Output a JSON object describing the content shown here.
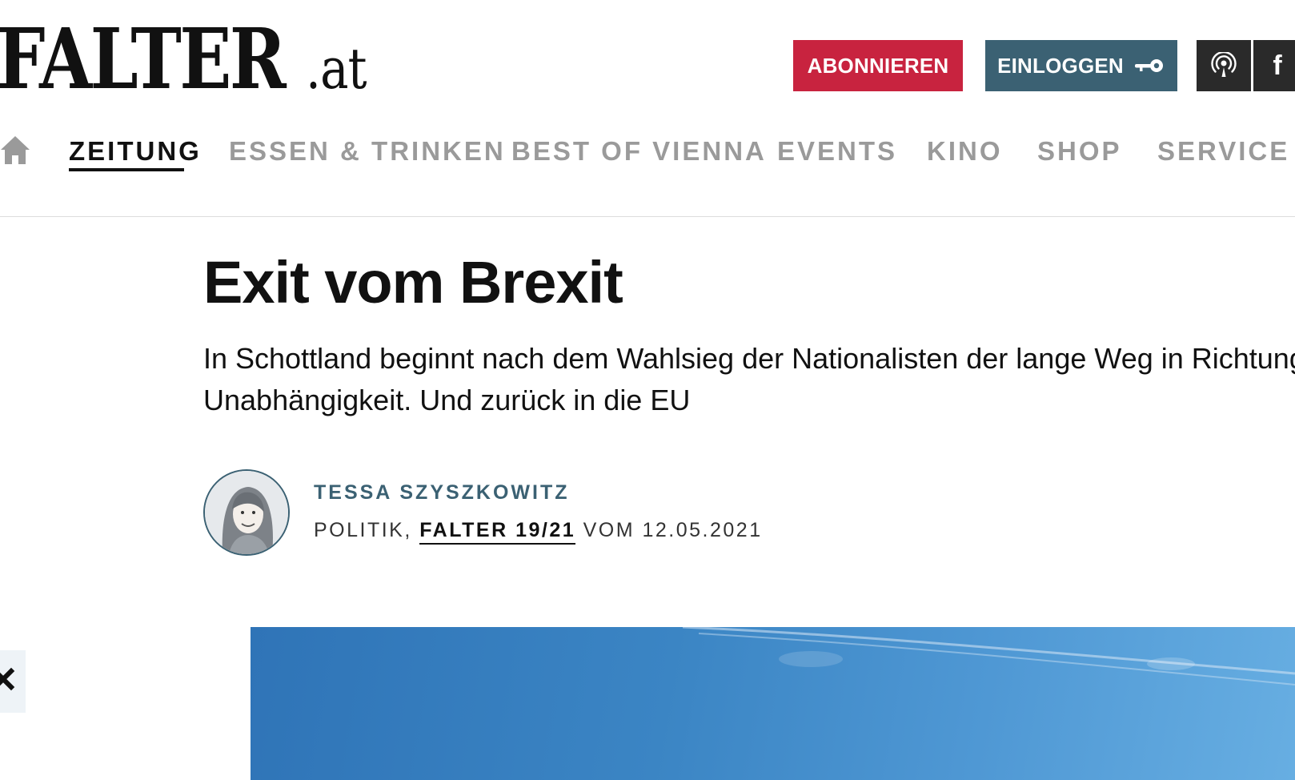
{
  "header": {
    "logo_main": "FALTER",
    "logo_suffix": ".at",
    "subscribe_label": "ABONNIEREN",
    "login_label": "EINLOGGEN",
    "icons": {
      "login": "key-icon",
      "podcast": "podcast-icon",
      "social": "facebook-icon"
    },
    "facebook_glyph": "f"
  },
  "nav": {
    "home_icon": "home-icon",
    "items": [
      {
        "label": "ZEITUNG",
        "active": true
      },
      {
        "label": "ESSEN & TRINKEN"
      },
      {
        "label": "BEST OF VIENNA"
      },
      {
        "label": "EVENTS"
      },
      {
        "label": "KINO"
      },
      {
        "label": "SHOP"
      },
      {
        "label": "SERVICE"
      }
    ]
  },
  "article": {
    "title": "Exit vom Brexit",
    "subtitle_line1": "In Schottland beginnt nach dem Wahlsieg der Nationalisten der lange Weg in Richtung",
    "subtitle_line2": "Unabhängigkeit. Und zurück in die EU",
    "author": "TESSA SZYSZKOWITZ",
    "section": "POLITIK, ",
    "issue": "FALTER 19/21",
    "date_text": " VOM 12.05.2021"
  },
  "colors": {
    "subscribe": "#c8233f",
    "login": "#3b6173",
    "social_bg": "#2a2a2a",
    "nav_inactive": "#9a9a9a",
    "author": "#3b6173",
    "sky": "#3b85c4"
  }
}
